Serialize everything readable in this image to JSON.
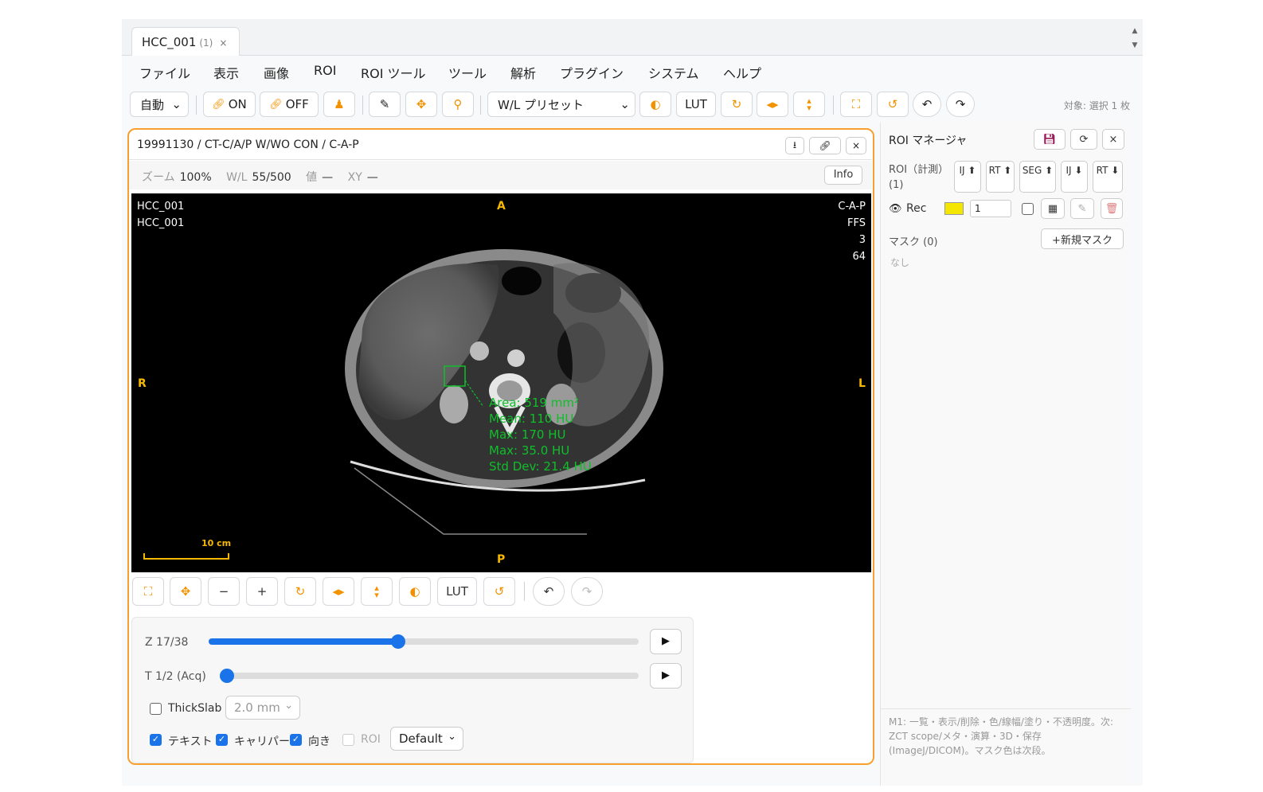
{
  "tab": {
    "name": "HCC_001",
    "count": "(1)",
    "close": "×"
  },
  "menu": [
    "ファイル",
    "表示",
    "画像",
    "ROI",
    "ROI ツール",
    "ツール",
    "解析",
    "プラグイン",
    "システム",
    "ヘルプ"
  ],
  "toolbar": {
    "mode_select": "自動",
    "on_label": "ON",
    "off_label": "OFF",
    "wl_preset": "W/L プリセット",
    "lut_label": "LUT",
    "target_text": "対象: 選択 1 枚"
  },
  "viewer": {
    "title": "19991130 / CT-C/A/P W/WO CON / C-A-P",
    "zoom_label": "ズーム",
    "zoom_value": "100%",
    "wl_label": "W/L",
    "wl_value": "55/500",
    "val_label": "値",
    "val_value": "—",
    "xy_label": "XY",
    "xy_value": "—",
    "info_button": "Info",
    "overlay": {
      "top_left": [
        "HCC_001",
        "HCC_001"
      ],
      "top_right": [
        "C-A-P",
        "FFS",
        "3",
        "64"
      ],
      "orientation": {
        "top": "A",
        "bottom": "P",
        "left": "R",
        "right": "L"
      },
      "scale_label": "10 cm"
    },
    "roi_stats": [
      "Area: 519 mm²",
      "Mean: 110 HU",
      "Max: 170 HU",
      "Max: 35.0 HU",
      "Std Dev: 21.4 HU"
    ],
    "bottom_toolbar": {
      "minus": "−",
      "plus": "+",
      "lut": "LUT"
    },
    "sliders": {
      "z_label": "Z 17/38",
      "z_fraction": 0.44,
      "t_label": "T 1/2 (Acq)",
      "t_fraction": 0.0
    },
    "thickslab": {
      "label": "ThickSlab",
      "value": "2.0 mm"
    },
    "toggles": [
      {
        "label": "テキスト",
        "checked": true
      },
      {
        "label": "キャリパー",
        "checked": true
      },
      {
        "label": "向き",
        "checked": true
      },
      {
        "label": "ROI",
        "checked": false
      }
    ],
    "preset_select": "Default"
  },
  "roi_manager": {
    "title": "ROI マネージャ",
    "roi_header": "ROI（計測）(1)",
    "import_export": [
      "IJ ⬆",
      "RT ⬆",
      "SEG ⬆",
      "IJ ⬇",
      "RT ⬇"
    ],
    "roi_row": {
      "name": "Rec",
      "color": "#f5e600",
      "value": "1"
    },
    "mask_header": "マスク (0)",
    "new_mask": "+新規マスク",
    "mask_empty": "なし",
    "footnote": "M1: 一覧・表示/削除・色/線幅/塗り・不透明度。次: ZCT scope/メタ・演算・3D・保存(ImageJ/DICOM)。マスク色は次段。"
  },
  "colors": {
    "accent": "#f39200",
    "panel_border": "#f7a030",
    "slider": "#1a73e8",
    "roi_green": "#0fbf2a",
    "overlay_orange": "#f6b800"
  }
}
